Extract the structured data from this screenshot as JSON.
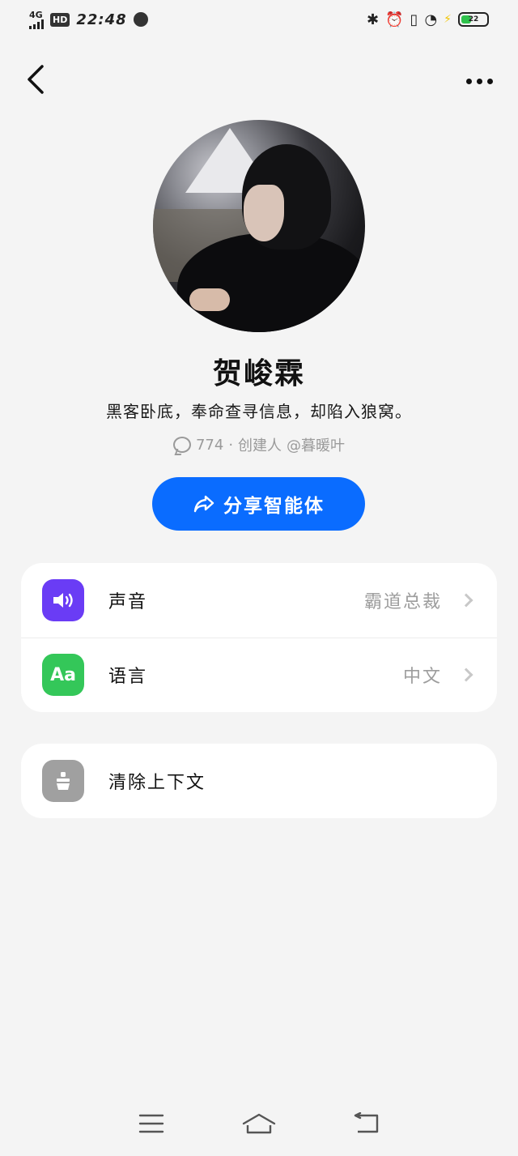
{
  "status_bar": {
    "network": "4G",
    "hd_badge": "HD",
    "time": "22:48",
    "battery_level": "22",
    "icons": [
      "signal-icon",
      "globe-icon",
      "bluetooth-icon",
      "alarm-icon",
      "vibrate-icon",
      "wifi-icon",
      "charging-icon",
      "battery-icon"
    ]
  },
  "header": {
    "back_icon": "chevron-left-icon",
    "more_icon": "more-dots-icon"
  },
  "profile": {
    "name": "贺峻霖",
    "description": "黑客卧底，奉命查寻信息，却陷入狼窝。",
    "chat_count": "774",
    "separator": "·",
    "creator_label": "创建人",
    "creator_handle": "@暮暖叶"
  },
  "share_button": {
    "label": "分享智能体",
    "icon": "share-icon"
  },
  "settings": [
    {
      "label": "声音",
      "value": "霸道总裁",
      "icon": "speaker-icon",
      "icon_color": "#6a3cf5"
    },
    {
      "label": "语言",
      "value": "中文",
      "icon": "text-aa-icon",
      "icon_text": "Aa",
      "icon_color": "#34c759"
    }
  ],
  "actions": [
    {
      "label": "清除上下文",
      "icon": "broom-icon",
      "icon_color": "#a0a0a0"
    }
  ],
  "colors": {
    "accent": "#0a6cff",
    "background": "#f4f4f4"
  }
}
